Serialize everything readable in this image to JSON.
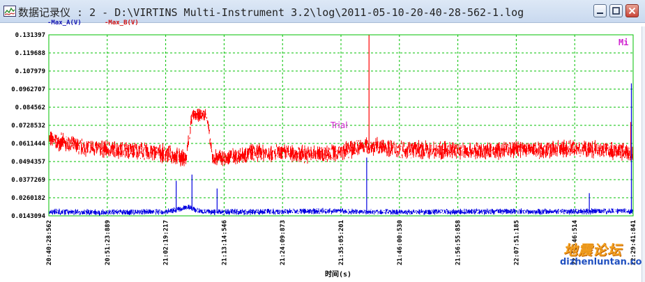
{
  "window": {
    "title": "数据记录仪 : 2 - D:\\VIRTINS Multi-Instrument 3.2\\log\\2011-05-10-20-40-28-562-1.log"
  },
  "chart": {
    "legend_a": "-Max_A(V)",
    "legend_b": "-Max_B(V)",
    "corner_label": "Mi",
    "marker_label": "Trial",
    "x_axis_label": "时间(s)",
    "watermark_cn": "地震论坛",
    "watermark_url": "dizhenluntan.com"
  },
  "chart_data": {
    "type": "line",
    "xlabel": "时间(s)",
    "ylabel": "",
    "y_ticks": [
      "0.131397",
      "0.119688",
      "0.107979",
      "0.0962707",
      "0.084562",
      "0.0728532",
      "0.0611444",
      "0.0494357",
      "0.0377269",
      "0.0260182",
      "0.0143094"
    ],
    "ylim": [
      0.0143094,
      0.131397
    ],
    "x_ticks": [
      "20:40:28:562",
      "20:51:23:889",
      "21:02:19:217",
      "21:13:14:546",
      "21:24:09:873",
      "21:35:05:201",
      "21:46:00:530",
      "21:56:55:858",
      "22:07:51:185",
      "22:18:46:514",
      "22:29:41:841"
    ],
    "grid": true,
    "colors": {
      "Max_A": "#0000e0",
      "Max_B": "#ff0000",
      "grid": "#00c000"
    },
    "series": [
      {
        "name": "Max_A(V)",
        "x_frac": [
          0,
          0.1,
          0.2,
          0.22,
          0.24,
          0.26,
          0.3,
          0.4,
          0.5,
          0.52,
          0.6,
          0.7,
          0.8,
          0.9,
          0.99,
          1.0
        ],
        "values": [
          0.017,
          0.0165,
          0.017,
          0.0185,
          0.02,
          0.017,
          0.0168,
          0.017,
          0.0175,
          0.017,
          0.0168,
          0.017,
          0.0172,
          0.017,
          0.0175,
          0.017
        ],
        "spikes": [
          {
            "x_frac": 0.218,
            "value": 0.037
          },
          {
            "x_frac": 0.245,
            "value": 0.041
          },
          {
            "x_frac": 0.288,
            "value": 0.032
          },
          {
            "x_frac": 0.544,
            "value": 0.052
          },
          {
            "x_frac": 0.925,
            "value": 0.029
          },
          {
            "x_frac": 0.997,
            "value": 0.1
          }
        ]
      },
      {
        "name": "Max_B(V)",
        "x_frac": [
          0,
          0.05,
          0.1,
          0.15,
          0.2,
          0.235,
          0.245,
          0.27,
          0.28,
          0.3,
          0.35,
          0.4,
          0.45,
          0.5,
          0.54,
          0.6,
          0.65,
          0.7,
          0.75,
          0.8,
          0.85,
          0.9,
          0.95,
          1.0
        ],
        "values": [
          0.064,
          0.059,
          0.0575,
          0.0565,
          0.0545,
          0.051,
          0.079,
          0.08,
          0.052,
          0.0515,
          0.0555,
          0.055,
          0.054,
          0.0555,
          0.06,
          0.0575,
          0.057,
          0.0565,
          0.056,
          0.0575,
          0.057,
          0.058,
          0.0575,
          0.0545
        ],
        "spikes": [
          {
            "x_frac": 0.548,
            "value": 0.1314
          },
          {
            "x_frac": 0.996,
            "value": 0.075
          }
        ]
      }
    ]
  }
}
